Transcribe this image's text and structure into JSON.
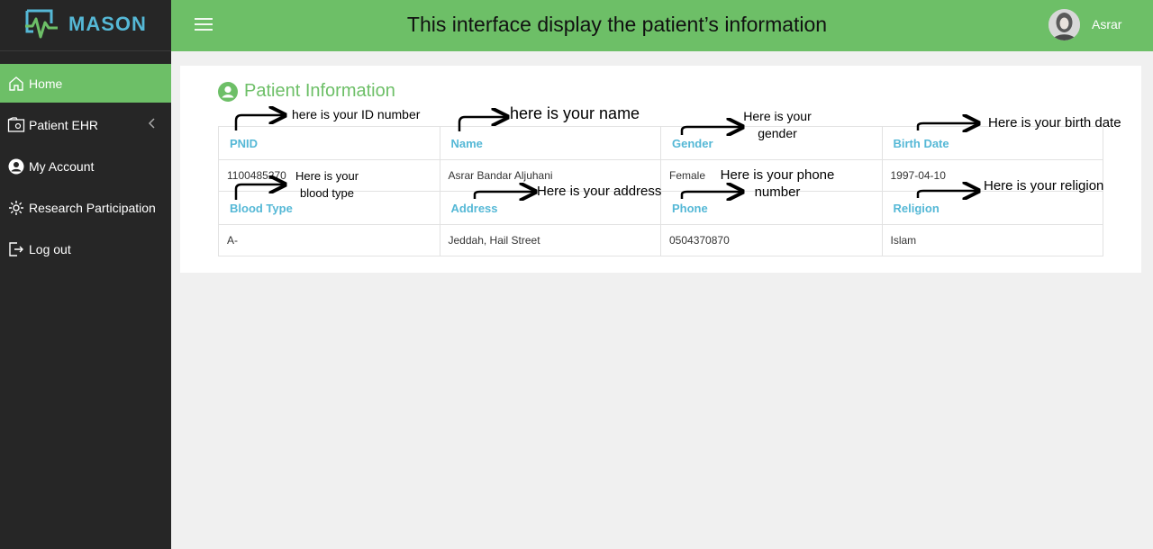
{
  "brand": {
    "name": "MASON",
    "color": "#55b8d6"
  },
  "header": {
    "title": "This interface display the patient’s information",
    "user_name": "Asrar",
    "bg_color": "#6dbf67"
  },
  "sidebar": {
    "items": [
      {
        "label": "Home",
        "icon": "home-icon",
        "active": true
      },
      {
        "label": "Patient EHR",
        "icon": "ehr-icon",
        "has_submenu": true
      },
      {
        "label": "My Account",
        "icon": "account-icon"
      },
      {
        "label": "Research Participation",
        "icon": "gear-icon"
      },
      {
        "label": "Log out",
        "icon": "logout-icon"
      }
    ]
  },
  "card": {
    "title": "Patient Information",
    "rows": [
      {
        "headers": [
          "PNID",
          "Name",
          "Gender",
          "Birth Date"
        ],
        "values": [
          "1100485270",
          "Asrar Bandar Aljuhani",
          "Female",
          "1997-04-10"
        ]
      },
      {
        "headers": [
          "Blood Type",
          "Address",
          "Phone",
          "Religion"
        ],
        "values": [
          "A-",
          "Jeddah, Hail Street",
          "0504370870",
          "Islam"
        ]
      }
    ]
  },
  "annotations": {
    "id": "here is your ID number",
    "name": "here is your name",
    "gender": "Here is your gender",
    "birth": "Here is your birth date",
    "blood": "Here is your blood type",
    "address": "Here is your address",
    "phone": "Here is your phone number",
    "religion": "Here is your religion"
  }
}
